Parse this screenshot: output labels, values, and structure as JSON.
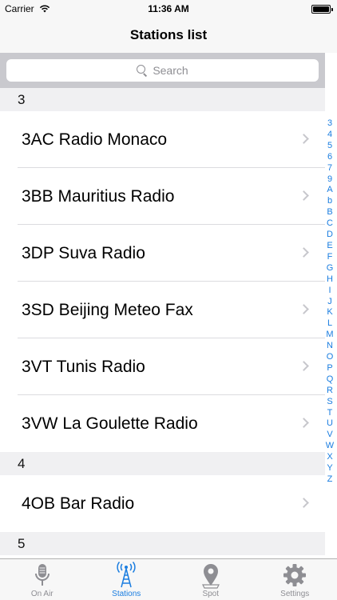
{
  "status_bar": {
    "carrier": "Carrier",
    "time": "11:36 AM"
  },
  "nav": {
    "title": "Stations list"
  },
  "search": {
    "placeholder": "Search"
  },
  "sections": [
    {
      "header": "3",
      "rows": [
        "3AC Radio Monaco",
        "3BB Mauritius Radio",
        "3DP Suva Radio",
        "3SD Beijing Meteo Fax",
        "3VT Tunis Radio",
        "3VW La Goulette Radio"
      ]
    },
    {
      "header": "4",
      "rows": [
        "4OB Bar Radio"
      ]
    },
    {
      "header": "5",
      "rows": []
    }
  ],
  "index": [
    "3",
    "4",
    "5",
    "6",
    "7",
    "9",
    "A",
    "b",
    "B",
    "C",
    "D",
    "E",
    "F",
    "G",
    "H",
    "I",
    "J",
    "K",
    "L",
    "M",
    "N",
    "O",
    "P",
    "Q",
    "R",
    "S",
    "T",
    "U",
    "V",
    "W",
    "X",
    "Y",
    "Z"
  ],
  "tabs": [
    {
      "label": "On Air",
      "icon": "microphone-icon",
      "active": false
    },
    {
      "label": "Stations",
      "icon": "antenna-tower-icon",
      "active": true
    },
    {
      "label": "Spot",
      "icon": "map-pin-icon",
      "active": false
    },
    {
      "label": "Settings",
      "icon": "gear-icon",
      "active": false
    }
  ],
  "colors": {
    "accent": "#1a7de0",
    "inactive": "#8e8e93"
  }
}
